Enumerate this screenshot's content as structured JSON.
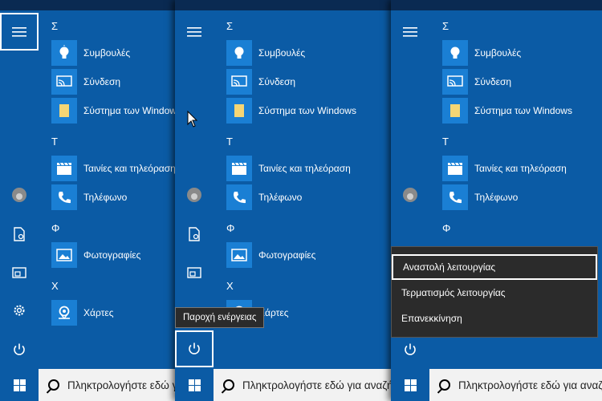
{
  "taskbar": {
    "search_placeholder": "Πληκτρολογήστε εδώ για αναζήτηση"
  },
  "sections": [
    {
      "letter": "Σ",
      "apps": [
        {
          "label": "Συμβουλές",
          "icon": "bulb-icon"
        },
        {
          "label": "Σύνδεση",
          "icon": "connect-icon"
        },
        {
          "label": "Σύστημα των Windows",
          "icon": "folder-icon"
        }
      ]
    },
    {
      "letter": "Τ",
      "apps": [
        {
          "label": "Ταινίες και τηλεόραση",
          "icon": "clapper-icon"
        },
        {
          "label": "Τηλέφωνο",
          "icon": "phone-icon"
        }
      ]
    },
    {
      "letter": "Φ",
      "apps": [
        {
          "label": "Φωτογραφίες",
          "icon": "photos-icon"
        }
      ]
    },
    {
      "letter": "Χ",
      "apps": [
        {
          "label": "Χάρτες",
          "icon": "maps-icon"
        }
      ]
    }
  ],
  "tooltip": "Παροχή ενέργειας",
  "power_menu": {
    "items": [
      "Αναστολή λειτουργίας",
      "Τερματισμός λειτουργίας",
      "Επανεκκίνηση"
    ]
  },
  "colors": {
    "start_bg": "#0b5ba5",
    "tile_bg": "#1a7fd4",
    "taskbar_bg": "#2a2a2a"
  }
}
